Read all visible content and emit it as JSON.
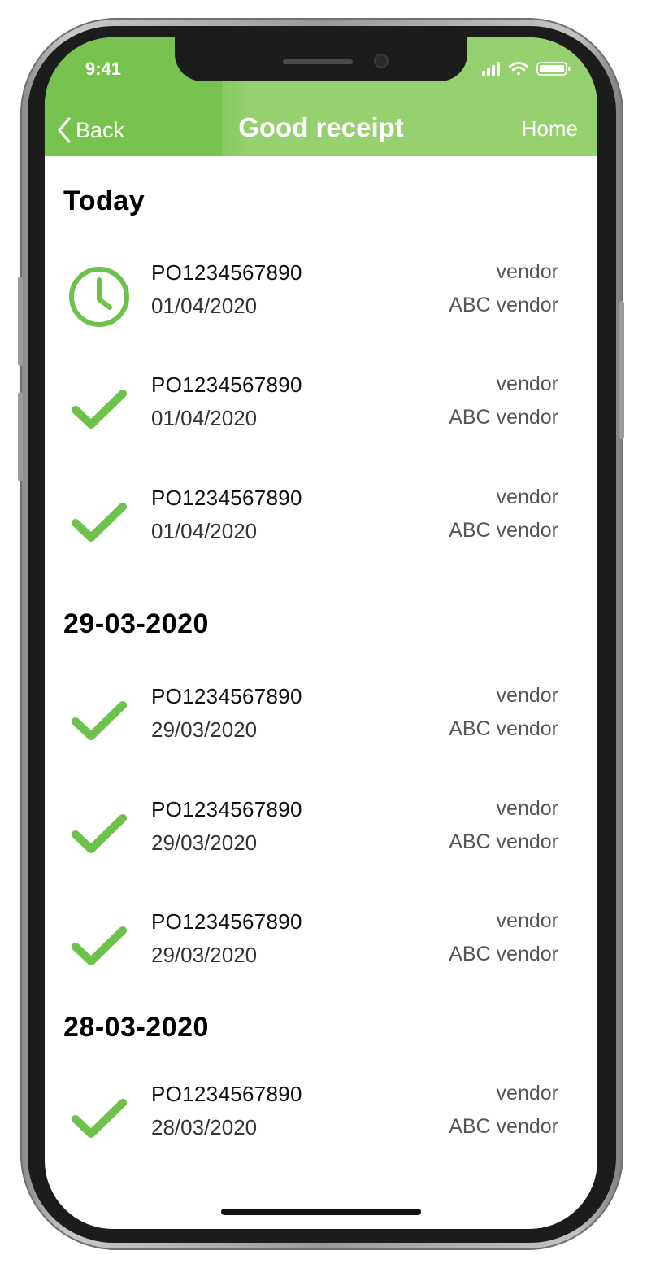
{
  "status_bar": {
    "time": "9:41"
  },
  "nav": {
    "back_label": "Back",
    "title": "Good receipt",
    "home_label": "Home"
  },
  "colors": {
    "accent": "#78c350",
    "header": "#97d06f",
    "icon": "#6cc24a"
  },
  "sections": [
    {
      "title": "Today",
      "items": [
        {
          "status": "clock-icon",
          "po": "PO1234567890",
          "date": "01/04/2020",
          "vendor_label": "vendor",
          "vendor_name": "ABC vendor"
        },
        {
          "status": "check-icon",
          "po": "PO1234567890",
          "date": "01/04/2020",
          "vendor_label": "vendor",
          "vendor_name": "ABC vendor"
        },
        {
          "status": "check-icon",
          "po": "PO1234567890",
          "date": "01/04/2020",
          "vendor_label": "vendor",
          "vendor_name": "ABC vendor"
        }
      ]
    },
    {
      "title": "29-03-2020",
      "items": [
        {
          "status": "check-icon",
          "po": "PO1234567890",
          "date": "29/03/2020",
          "vendor_label": "vendor",
          "vendor_name": "ABC vendor"
        },
        {
          "status": "check-icon",
          "po": "PO1234567890",
          "date": "29/03/2020",
          "vendor_label": "vendor",
          "vendor_name": "ABC vendor"
        },
        {
          "status": "check-icon",
          "po": "PO1234567890",
          "date": "29/03/2020",
          "vendor_label": "vendor",
          "vendor_name": "ABC vendor"
        }
      ]
    },
    {
      "title": "28-03-2020",
      "items": [
        {
          "status": "check-icon",
          "po": "PO1234567890",
          "date": "28/03/2020",
          "vendor_label": "vendor",
          "vendor_name": "ABC vendor"
        }
      ]
    }
  ]
}
